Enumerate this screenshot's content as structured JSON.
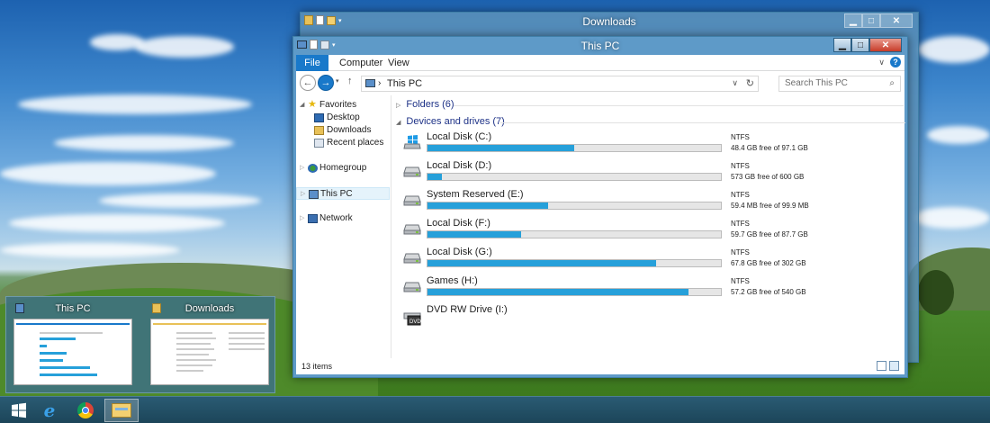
{
  "taskbar": {
    "items": [
      "start",
      "internet-explorer",
      "chrome",
      "file-explorer"
    ]
  },
  "thumbnails": [
    {
      "title": "This PC"
    },
    {
      "title": "Downloads"
    }
  ],
  "back_window": {
    "title": "Downloads"
  },
  "window": {
    "title": "This PC",
    "ribbon_tabs": [
      "File",
      "Computer",
      "View"
    ],
    "address": "This PC",
    "search_placeholder": "Search This PC",
    "nav": {
      "favorites": "Favorites",
      "desktop": "Desktop",
      "downloads": "Downloads",
      "recent": "Recent places",
      "homegroup": "Homegroup",
      "this_pc": "This PC",
      "network": "Network"
    },
    "groups": {
      "folders": "Folders (6)",
      "devices": "Devices and drives (7)"
    },
    "drives": [
      {
        "name": "Local Disk (C:)",
        "fs": "NTFS",
        "free": "48.4 GB free of 97.1 GB",
        "used_fraction": 0.5,
        "icon": "windows-drive-icon"
      },
      {
        "name": "Local Disk (D:)",
        "fs": "NTFS",
        "free": "573 GB free of 600 GB",
        "used_fraction": 0.05,
        "icon": "hard-drive-icon"
      },
      {
        "name": "System Reserved (E:)",
        "fs": "NTFS",
        "free": "59.4 MB free of 99.9 MB",
        "used_fraction": 0.41,
        "icon": "hard-drive-icon"
      },
      {
        "name": "Local Disk (F:)",
        "fs": "NTFS",
        "free": "59.7 GB free of 87.7 GB",
        "used_fraction": 0.32,
        "icon": "hard-drive-icon"
      },
      {
        "name": "Local Disk (G:)",
        "fs": "NTFS",
        "free": "67.8 GB free of 302 GB",
        "used_fraction": 0.78,
        "icon": "hard-drive-icon"
      },
      {
        "name": "Games (H:)",
        "fs": "NTFS",
        "free": "57.2 GB free of 540 GB",
        "used_fraction": 0.89,
        "icon": "hard-drive-icon"
      },
      {
        "name": "DVD RW Drive (I:)",
        "fs": "",
        "free": "",
        "used_fraction": null,
        "icon": "dvd-drive-icon"
      }
    ],
    "status": "13 items"
  },
  "colors": {
    "accent": "#1979ca",
    "bar": "#26a0da",
    "group_header": "#1e3287"
  }
}
